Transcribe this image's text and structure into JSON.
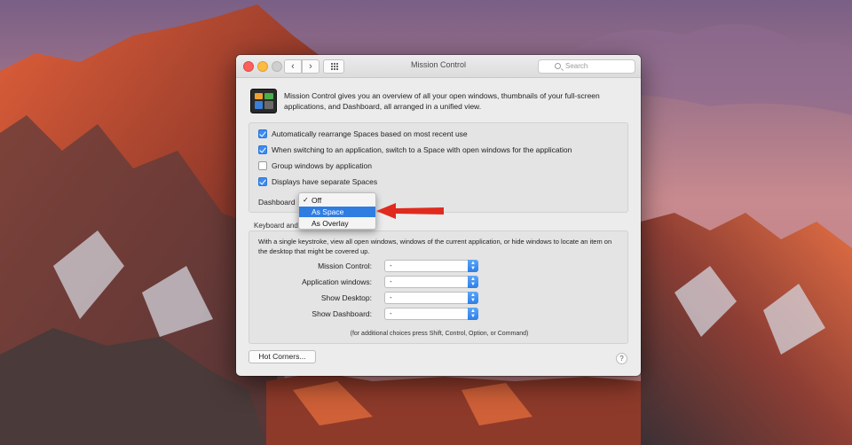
{
  "window": {
    "title": "Mission Control",
    "search_placeholder": "Search",
    "nav_back": "‹",
    "nav_forward": "›"
  },
  "intro": {
    "description": "Mission Control gives you an overview of all your open windows, thumbnails of your full-screen applications, and Dashboard, all arranged in a unified view."
  },
  "options": [
    {
      "label": "Automatically rearrange Spaces based on most recent use",
      "checked": true
    },
    {
      "label": "When switching to an application, switch to a Space with open windows for the application",
      "checked": true
    },
    {
      "label": "Group windows by application",
      "checked": false
    },
    {
      "label": "Displays have separate Spaces",
      "checked": true
    }
  ],
  "dashboard": {
    "label": "Dashboard",
    "menu_items": [
      {
        "label": "Off",
        "checked": true,
        "highlighted": false
      },
      {
        "label": "As Space",
        "checked": false,
        "highlighted": true
      },
      {
        "label": "As Overlay",
        "checked": false,
        "highlighted": false
      }
    ],
    "check_glyph": "✓"
  },
  "shortcuts": {
    "section_title": "Keyboard and",
    "description": "With a single keystroke, view all open windows, windows of the current application, or hide windows to locate an item on the desktop that might be covered up.",
    "rows": [
      {
        "label": "Mission Control:",
        "value": "-"
      },
      {
        "label": "Application windows:",
        "value": "-"
      },
      {
        "label": "Show Desktop:",
        "value": "-"
      },
      {
        "label": "Show Dashboard:",
        "value": "-"
      }
    ],
    "footnote": "(for additional choices press Shift, Control, Option, or Command)"
  },
  "footer": {
    "hot_corners_label": "Hot Corners...",
    "help_label": "?"
  },
  "colors": {
    "accent": "#2f7de1",
    "annotation_arrow": "#e02a1e"
  }
}
